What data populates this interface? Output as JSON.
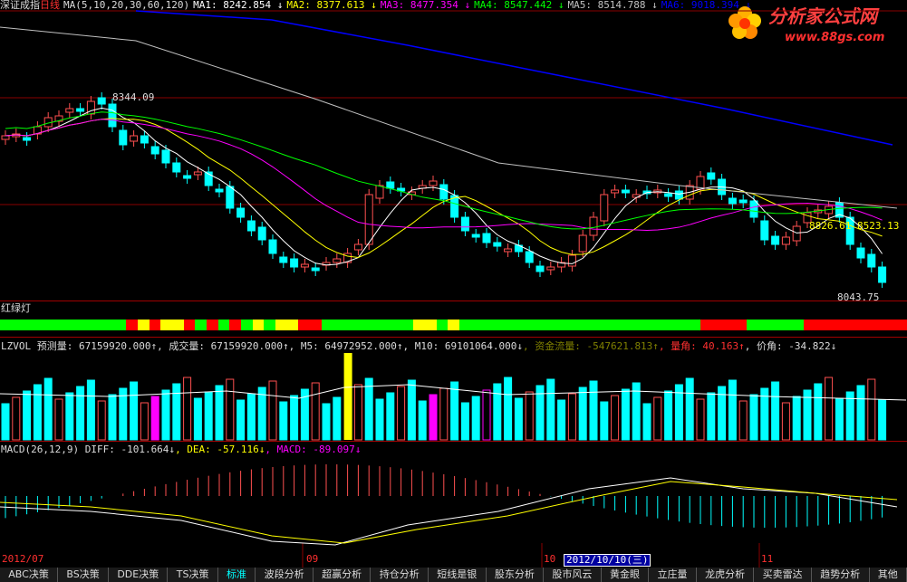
{
  "main": {
    "name": "深证成指",
    "period": "日线",
    "ma_param": "MA(5,10,20,30,60,120)",
    "ma": [
      {
        "label": "MA1:",
        "value": "8242.854",
        "arrow": "↓",
        "color": "#ffffff"
      },
      {
        "label": "MA2:",
        "value": "8377.613",
        "arrow": "↓",
        "color": "#ffff00"
      },
      {
        "label": "MA3:",
        "value": "8477.354",
        "arrow": "↓",
        "color": "#ff00ff"
      },
      {
        "label": "MA4:",
        "value": "8547.442",
        "arrow": "↓",
        "color": "#00ff00"
      },
      {
        "label": "MA5:",
        "value": "8514.788",
        "arrow": "↓",
        "color": "#c0c0c0"
      },
      {
        "label": "MA6:",
        "value": "9018.394",
        "arrow": "↓",
        "color": "#0000ff"
      }
    ],
    "high_label": "8344.09",
    "right_label": "8826.61 8523.13",
    "low_label": "8043.75"
  },
  "logo": {
    "title": "分析家公式网",
    "url": "www.88gs.com"
  },
  "signal": {
    "title": "红绿灯",
    "segments": [
      {
        "color": "#00ff00",
        "n": 11
      },
      {
        "color": "#ff0000",
        "n": 1
      },
      {
        "color": "#ffff00",
        "n": 1
      },
      {
        "color": "#ff0000",
        "n": 1
      },
      {
        "color": "#ffff00",
        "n": 2
      },
      {
        "color": "#ff0000",
        "n": 1
      },
      {
        "color": "#00ff00",
        "n": 1
      },
      {
        "color": "#ff0000",
        "n": 1
      },
      {
        "color": "#00ff00",
        "n": 1
      },
      {
        "color": "#ff0000",
        "n": 1
      },
      {
        "color": "#00ff00",
        "n": 1
      },
      {
        "color": "#ffff00",
        "n": 1
      },
      {
        "color": "#00ff00",
        "n": 1
      },
      {
        "color": "#ffff00",
        "n": 2
      },
      {
        "color": "#ff0000",
        "n": 2
      },
      {
        "color": "#00ff00",
        "n": 8
      },
      {
        "color": "#ffff00",
        "n": 2
      },
      {
        "color": "#00ff00",
        "n": 1
      },
      {
        "color": "#ffff00",
        "n": 1
      },
      {
        "color": "#00ff00",
        "n": 21
      },
      {
        "color": "#ff0000",
        "n": 4
      },
      {
        "color": "#00ff00",
        "n": 5
      },
      {
        "color": "#ff0000",
        "n": 9
      }
    ]
  },
  "vol": {
    "fields": [
      {
        "text": "LZVOL 预测量: 67159920.000",
        "arrow": "↑",
        "color": "#dcdcdc"
      },
      {
        "text": ", 成交量: 67159920.000",
        "arrow": "↑",
        "color": "#dcdcdc"
      },
      {
        "text": ", M5: 64972952.000",
        "arrow": "↑",
        "color": "#dcdcdc"
      },
      {
        "text": ", M10: 69101064.000",
        "arrow": "↓",
        "color": "#dcdcdc"
      },
      {
        "text": ", 资金流量: -547621.813",
        "arrow": "↑",
        "color": "#808000"
      },
      {
        "text": ", 量角: 40.163",
        "arrow": "↑",
        "color": "#ff3030"
      },
      {
        "text": ", 价角: -34.822",
        "arrow": "↓",
        "color": "#dcdcdc"
      }
    ]
  },
  "macd": {
    "fields": [
      {
        "text": "MACD(26,12,9) DIFF: -101.664",
        "arrow": "↓",
        "color": "#dcdcdc"
      },
      {
        "text": ", DEA: -57.116",
        "arrow": "↓",
        "color": "#ffff00"
      },
      {
        "text": ", MACD: -89.097",
        "arrow": "↓",
        "color": "#ff00ff"
      }
    ]
  },
  "dates": {
    "d1": "2012/07",
    "d2": "09",
    "d3": "10",
    "d4": "2012/10/10(三)",
    "d5": "11"
  },
  "tabs": [
    "ABC决策",
    "BS决策",
    "DDE决策",
    "TS决策",
    "标准",
    "波段分析",
    "超赢分析",
    "持仓分析",
    "短线是银",
    "股东分析",
    "股市风云",
    "黄金眼",
    "立庄量",
    "龙虎分析",
    "买卖雷达",
    "趋势分析",
    "其他"
  ],
  "active_tab": 4
}
